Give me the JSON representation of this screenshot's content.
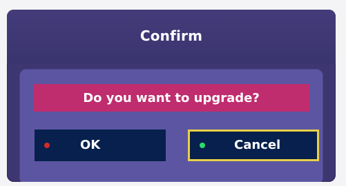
{
  "dialog": {
    "title": "Confirm",
    "message": "Do you want to upgrade?",
    "buttons": {
      "ok": {
        "label": "OK",
        "key_color": "red"
      },
      "cancel": {
        "label": "Cancel",
        "key_color": "green",
        "selected": true
      }
    },
    "colors": {
      "dialog_background": "#3d3670",
      "panel_background": "#5c56a2",
      "message_bar": "#bf2d6e",
      "button_background": "#07204d",
      "focus_border": "#e7d14a",
      "ok_key": "#d42a2a",
      "cancel_key": "#2bdc68"
    }
  }
}
